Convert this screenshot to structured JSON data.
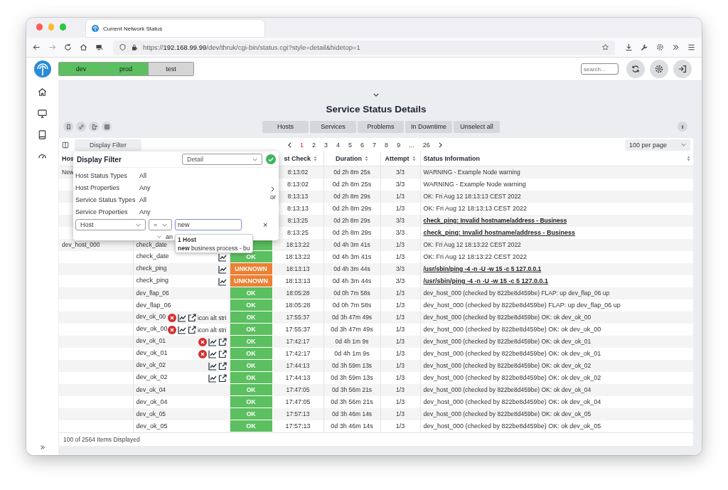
{
  "browser": {
    "tab_title": "Current Network Status",
    "url": {
      "scheme": "https://",
      "host": "192.168.99.99",
      "path": "/dev/thruk/cgi-bin/status.cgi?style=detail&hidetop=1"
    }
  },
  "environments": [
    {
      "label": "dev",
      "on": true
    },
    {
      "label": "prod",
      "on": true
    },
    {
      "label": "test",
      "on": false
    }
  ],
  "search": {
    "placeholder": "search..."
  },
  "page_title": "Service Status Details",
  "view_buttons": [
    "Hosts",
    "Services",
    "Problems",
    "In Downtime",
    "Unselect all"
  ],
  "info_button": "i",
  "display_filter_button": "Display Filter",
  "pagination": {
    "pages": [
      {
        "label": "1",
        "selected": true
      },
      {
        "label": "2",
        "selected": false
      },
      {
        "label": "3",
        "selected": false
      },
      {
        "label": "4",
        "selected": false
      },
      {
        "label": "5",
        "selected": false
      },
      {
        "label": "6",
        "selected": false
      },
      {
        "label": "7",
        "selected": false
      },
      {
        "label": "8",
        "selected": false
      },
      {
        "label": "9",
        "selected": false
      },
      {
        "label": "...",
        "selected": false
      },
      {
        "label": "26",
        "selected": false
      }
    ]
  },
  "per_page": "100 per page",
  "table": {
    "columns": [
      {
        "label": "Hos"
      },
      {
        "label": "st Check",
        "sortable": true
      },
      {
        "label": "Duration",
        "sortable": true
      },
      {
        "label": "Attempt",
        "sortable": true
      },
      {
        "label": "Status Information",
        "sortable": true
      }
    ],
    "rows": [
      {
        "host": "New",
        "last_check": "8:13:02",
        "duration": "0d 2h 8m 25s",
        "attempt": "3/3",
        "info": "WARNING - Example Node warning",
        "emphasis": false
      },
      {
        "last_check": "8:13:02",
        "duration": "0d 2h 8m 25s",
        "attempt": "3/3",
        "info": "WARNING - Example Node warning",
        "emphasis": false
      },
      {
        "last_check": "8:13:13",
        "duration": "0d 2h 8m 29s",
        "attempt": "1/3",
        "info": "OK: Fri Aug 12 18:13:13 CEST 2022",
        "emphasis": false
      },
      {
        "last_check": "8:13:13",
        "duration": "0d 2h 8m 29s",
        "attempt": "1/3",
        "info": "OK: Fri Aug 12 18:13:13 CEST 2022",
        "emphasis": false
      },
      {
        "last_check": "8:13:25",
        "duration": "0d 2h 8m 29s",
        "attempt": "3/3",
        "info": "check_ping: Invalid hostname/address - Business",
        "emphasis": true
      },
      {
        "last_check": "8:13:25",
        "duration": "0d 2h 8m 29s",
        "attempt": "3/3",
        "info": "check_ping: Invalid hostname/address - Business",
        "emphasis": true
      },
      {
        "host": "dev_host_000",
        "service": "check_date",
        "status": {
          "kind": "ok"
        },
        "last_check": "18:13:22",
        "duration": "0d 4h 3m 41s",
        "attempt": "1/3",
        "info": "OK: Fri Aug 12 18:13:22 CEST 2022",
        "emphasis": false
      },
      {
        "service": "check_date",
        "icons": [
          {
            "kind": "graph"
          }
        ],
        "status": {
          "kind": "ok",
          "label": "OK"
        },
        "last_check": "18:13:22",
        "duration": "0d 4h 3m 41s",
        "attempt": "1/3",
        "info": "OK: Fri Aug 12 18:13:22 CEST 2022",
        "emphasis": false
      },
      {
        "service": "check_ping",
        "icons": [
          {
            "kind": "graph"
          }
        ],
        "status": {
          "kind": "unknown",
          "label": "UNKNOWN"
        },
        "last_check": "18:13:13",
        "duration": "0d 4h 3m 44s",
        "attempt": "3/3",
        "info": "/usr/sbin/ping -4 -n -U -w 15 -c 5 127.0.0.1",
        "emphasis": true
      },
      {
        "service": "check_ping",
        "icons": [
          {
            "kind": "graph"
          }
        ],
        "status": {
          "kind": "unknown",
          "label": "UNKNOWN"
        },
        "last_check": "18:13:13",
        "duration": "0d 4h 3m 44s",
        "attempt": "3/3",
        "info": "/usr/sbin/ping -4 -n -U -w 15 -c 5 127.0.0.1",
        "emphasis": true
      },
      {
        "service": "dev_flap_06",
        "status": {
          "kind": "ok",
          "label": "OK"
        },
        "last_check": "18:05:28",
        "duration": "0d 0h 7m 58s",
        "attempt": "1/3",
        "info": "dev_host_000 (checked by 822be8d459be) FLAP: up dev_flap_06 up",
        "emphasis": false
      },
      {
        "service": "dev_flap_06",
        "status": {
          "kind": "ok",
          "label": "OK"
        },
        "last_check": "18:05:28",
        "duration": "0d 0h 7m 58s",
        "attempt": "1/3",
        "info": "dev_host_000 (checked by 822be8d459be) FLAP: up dev_flap_06 up",
        "emphasis": false
      },
      {
        "service": "dev_ok_00",
        "icons": [
          {
            "kind": "cancel"
          },
          {
            "kind": "graph"
          },
          {
            "kind": "link"
          }
        ],
        "icon_alt": "icon alt stri",
        "status": {
          "kind": "ok",
          "label": "OK"
        },
        "last_check": "17:55:37",
        "duration": "0d 3h 47m 49s",
        "attempt": "1/3",
        "info": "dev_host_000 (checked by 822be8d459be) OK: ok dev_ok_00",
        "emphasis": false
      },
      {
        "service": "dev_ok_00",
        "icons": [
          {
            "kind": "cancel"
          },
          {
            "kind": "graph"
          },
          {
            "kind": "link"
          }
        ],
        "icon_alt": "icon alt stri",
        "status": {
          "kind": "ok",
          "label": "OK"
        },
        "last_check": "17:55:37",
        "duration": "0d 3h 47m 49s",
        "attempt": "1/3",
        "info": "dev_host_000 (checked by 822be8d459be) OK: ok dev_ok_00",
        "emphasis": false
      },
      {
        "service": "dev_ok_01",
        "icons": [
          {
            "kind": "cancel"
          },
          {
            "kind": "graph"
          },
          {
            "kind": "link"
          }
        ],
        "status": {
          "kind": "ok",
          "label": "OK"
        },
        "last_check": "17:42:17",
        "duration": "0d 4h 1m 9s",
        "attempt": "1/3",
        "info": "dev_host_000 (checked by 822be8d459be) OK: ok dev_ok_01",
        "emphasis": false
      },
      {
        "service": "dev_ok_01",
        "icons": [
          {
            "kind": "cancel"
          },
          {
            "kind": "graph"
          },
          {
            "kind": "link"
          }
        ],
        "status": {
          "kind": "ok",
          "label": "OK"
        },
        "last_check": "17:42:17",
        "duration": "0d 4h 1m 9s",
        "attempt": "1/3",
        "info": "dev_host_000 (checked by 822be8d459be) OK: ok dev_ok_01",
        "emphasis": false
      },
      {
        "service": "dev_ok_02",
        "icons": [
          {
            "kind": "graph"
          },
          {
            "kind": "link"
          }
        ],
        "status": {
          "kind": "ok",
          "label": "OK"
        },
        "last_check": "17:44:13",
        "duration": "0d 3h 59m 13s",
        "attempt": "1/3",
        "info": "dev_host_000 (checked by 822be8d459be) OK: ok dev_ok_02",
        "emphasis": false
      },
      {
        "service": "dev_ok_02",
        "icons": [
          {
            "kind": "graph"
          },
          {
            "kind": "link"
          }
        ],
        "status": {
          "kind": "ok",
          "label": "OK"
        },
        "last_check": "17:44:13",
        "duration": "0d 3h 59m 13s",
        "attempt": "1/3",
        "info": "dev_host_000 (checked by 822be8d459be) OK: ok dev_ok_02",
        "emphasis": false
      },
      {
        "service": "dev_ok_04",
        "status": {
          "kind": "ok",
          "label": "OK"
        },
        "last_check": "17:47:05",
        "duration": "0d 3h 56m 21s",
        "attempt": "1/3",
        "info": "dev_host_000 (checked by 822be8d459be) OK: ok dev_ok_04",
        "emphasis": false
      },
      {
        "service": "dev_ok_04",
        "status": {
          "kind": "ok",
          "label": "OK"
        },
        "last_check": "17:47:05",
        "duration": "0d 3h 56m 21s",
        "attempt": "1/3",
        "info": "dev_host_000 (checked by 822be8d459be) OK: ok dev_ok_04",
        "emphasis": false
      },
      {
        "service": "dev_ok_05",
        "status": {
          "kind": "ok",
          "label": "OK"
        },
        "last_check": "17:57:13",
        "duration": "0d 3h 46m 14s",
        "attempt": "1/3",
        "info": "dev_host_000 (checked by 822be8d459be) OK: ok dev_ok_05",
        "emphasis": false
      },
      {
        "service": "dev_ok_05",
        "status": {
          "kind": "ok",
          "label": "OK"
        },
        "last_check": "17:57:13",
        "duration": "0d 3h 46m 14s",
        "attempt": "1/3",
        "info": "dev_host_000 (checked by 822be8d459be) OK: ok dev_ok_05",
        "emphasis": false
      }
    ]
  },
  "footer": "100 of 2564 Items Displayed",
  "filter": {
    "title": "Display Filter",
    "view": "Detail",
    "properties": [
      {
        "label": "Host Status Types",
        "value": "All"
      },
      {
        "label": "Host Properties",
        "value": "Any"
      },
      {
        "label": "Service Status Types",
        "value": "All"
      },
      {
        "label": "Service Properties",
        "value": "Any"
      }
    ],
    "field": "Host",
    "operator": "=",
    "value": "new",
    "remove": "×",
    "or_label": "or",
    "and_label": "an",
    "suggestions": {
      "header": "1 Host",
      "items": [
        "**new** business process - bu"
      ]
    }
  }
}
